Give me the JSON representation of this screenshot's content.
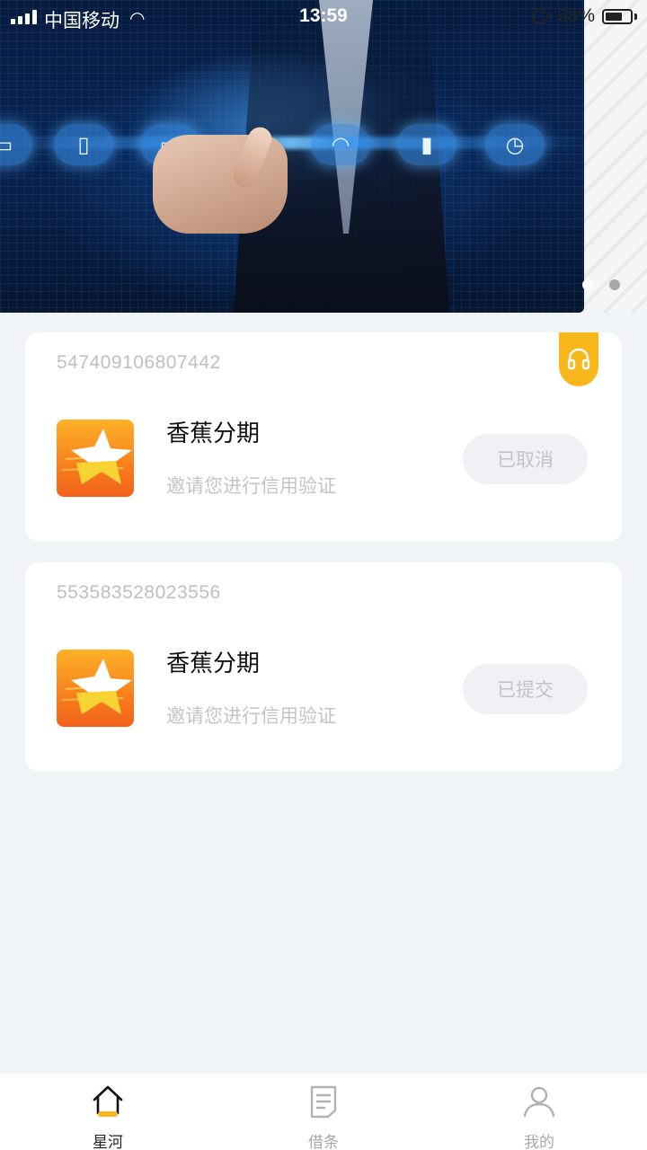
{
  "status_bar": {
    "carrier": "中国移动",
    "time": "13:59",
    "battery_percent": "68%",
    "battery_level": 0.68
  },
  "banner": {
    "slide_count": 2,
    "active_slide": 1
  },
  "orders": [
    {
      "order_no": "547409106807442",
      "app_name": "香蕉分期",
      "subtitle": "邀请您进行信用验证",
      "status": "已取消"
    },
    {
      "order_no": "553583528023556",
      "app_name": "香蕉分期",
      "subtitle": "邀请您进行信用验证",
      "status": "已提交"
    }
  ],
  "service": {
    "icon": "headset-icon"
  },
  "bottom_nav": {
    "items": [
      {
        "label": "星河",
        "icon": "home-icon",
        "active": true
      },
      {
        "label": "借条",
        "icon": "document-icon",
        "active": false
      },
      {
        "label": "我的",
        "icon": "user-icon",
        "active": false
      }
    ]
  },
  "colors": {
    "accent": "#f8b81b",
    "page_bg": "#f0f4f7",
    "muted_text": "#c4c4c4"
  }
}
